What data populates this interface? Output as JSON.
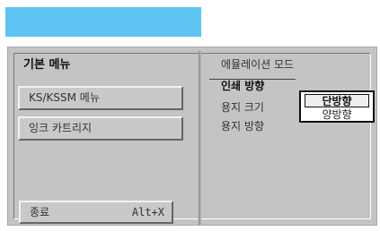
{
  "menu": {
    "title": "기본 메뉴",
    "buttons": [
      "KS/KSSM 메뉴",
      "잉크 카트리지"
    ],
    "exit_label": "종료",
    "exit_shortcut": "Alt+X"
  },
  "settings": {
    "emulation_label": "에뮬레이션 모드",
    "print_direction_label": "인쇄 방향",
    "paper_size_label": "용지 크기",
    "paper_direction_label": "용지 방향",
    "options": [
      "단방향",
      "양방향"
    ]
  },
  "colors": {
    "header_bar": "#5ec4f2",
    "panel": "#c4c4c4"
  }
}
